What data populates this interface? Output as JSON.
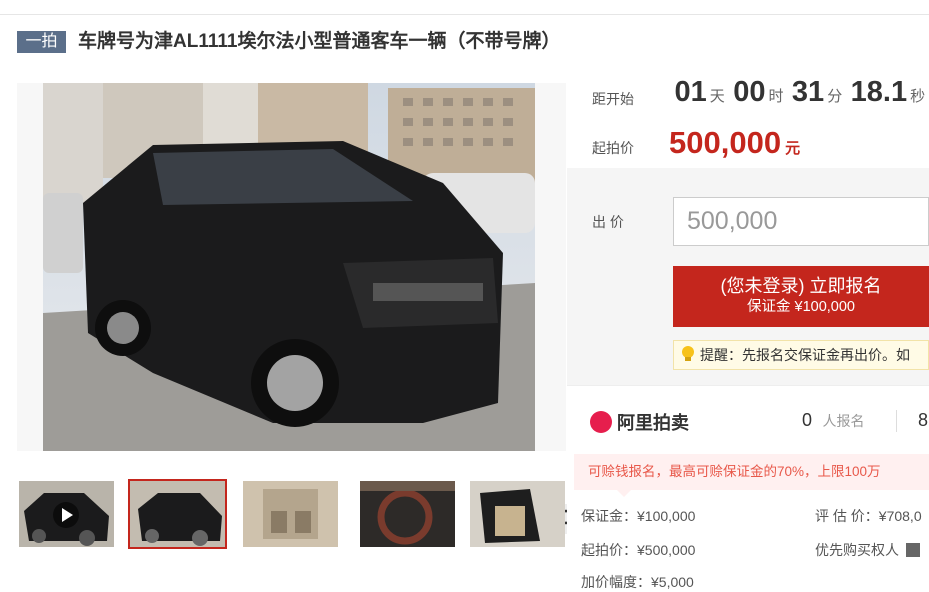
{
  "header": {
    "tag": "一拍",
    "title": "车牌号为津AL1111埃尔法小型普通客车一辆（不带号牌）"
  },
  "countdown": {
    "label": "距开始",
    "days": "01",
    "days_unit": "天",
    "hours": "00",
    "hours_unit": "时",
    "minutes": "31",
    "minutes_unit": "分",
    "seconds": "18.1",
    "seconds_unit": "秒"
  },
  "start_price": {
    "label": "起拍价",
    "value": "500,000",
    "unit": "元"
  },
  "bid": {
    "label": "出 价",
    "placeholder": "500,000",
    "button_line1": "(您未登录) 立即报名",
    "button_line2": "保证金 ¥100,000",
    "reminder": "提醒：先报名交保证金再出价。如"
  },
  "stats": {
    "brand": "阿里拍卖",
    "signup_count": "0",
    "signup_label": "人报名",
    "partial_count": "8"
  },
  "tooltip": "可赊钱报名，最高可赊保证金的70%，上限100万",
  "details": {
    "deposit": "保证金：¥100,000",
    "appraisal": "评 估 价：¥708,0",
    "start": "起拍价：¥500,000",
    "priority": "优先购买权人",
    "increment": "加价幅度：¥5,000"
  },
  "thumbnails": [
    {
      "name": "thumb-1",
      "video": true
    },
    {
      "name": "thumb-2",
      "selected": true
    },
    {
      "name": "thumb-3"
    },
    {
      "name": "thumb-4"
    },
    {
      "name": "thumb-5"
    }
  ],
  "colors": {
    "accent_red": "#c4261d",
    "tag_blue": "#5b6f8a",
    "brand_pink": "#e61e4d"
  }
}
